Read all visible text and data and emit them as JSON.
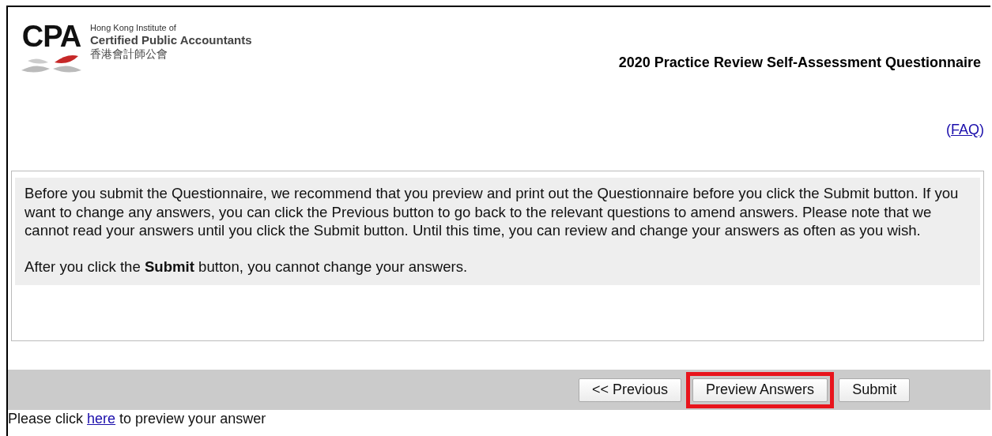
{
  "logo": {
    "mark": "CPA",
    "lines": [
      "Hong Kong Institute of",
      "Certified Public Accountants",
      "香港會計師公會"
    ]
  },
  "title": "2020 Practice Review Self-Assessment Questionnaire",
  "faq": {
    "before": "(",
    "link": "FAQ",
    "after": ")"
  },
  "notice": {
    "paragraphs": [
      "Before you submit the Questionnaire, we recommend that you preview and print out the Questionnaire before you click the Submit button. If you want to change any answers, you can click the Previous button to go back to the relevant questions to amend answers. Please note that we cannot read your answers until you click the Submit button. Until this time, you can review and change your answers as often as you wish.",
      "After you click the **Submit** button, you cannot change your answers."
    ]
  },
  "buttons": [
    {
      "label": "<< Previous",
      "highlighted": false
    },
    {
      "label": "Preview Answers",
      "highlighted": true
    },
    {
      "label": "Submit",
      "highlighted": false
    }
  ],
  "footer": {
    "before": "Please click ",
    "link": "here",
    "after": " to preview your answer"
  }
}
